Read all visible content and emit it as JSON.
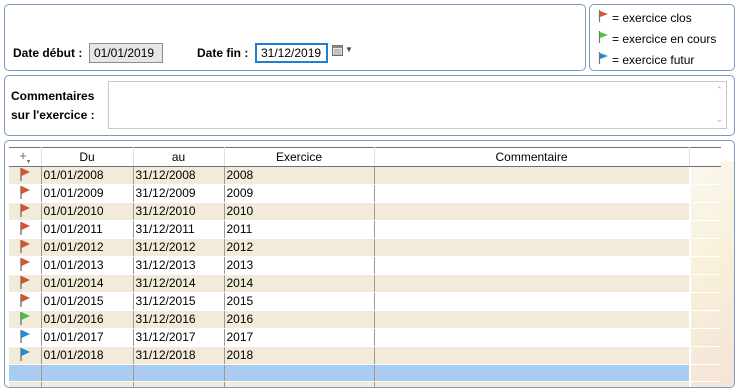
{
  "dates": {
    "start_label": "Date début :",
    "start_value": "01/01/2019",
    "end_label": "Date fin :",
    "end_value": "31/12/2019"
  },
  "legend": {
    "items": [
      {
        "color": "#d9542b",
        "label": "= exercice clos"
      },
      {
        "color": "#4cc23d",
        "label": "= exercice en cours"
      },
      {
        "color": "#1f8bd8",
        "label": "= exercice futur"
      }
    ]
  },
  "comment": {
    "label_line1": "Commentaires",
    "label_line2": "sur l'exercice :",
    "value": ""
  },
  "grid": {
    "columns": [
      "Du",
      "au",
      "Exercice",
      "Commentaire"
    ],
    "rows": [
      {
        "status": "clos",
        "du": "01/01/2008",
        "au": "31/12/2008",
        "exercice": "2008",
        "commentaire": ""
      },
      {
        "status": "clos",
        "du": "01/01/2009",
        "au": "31/12/2009",
        "exercice": "2009",
        "commentaire": ""
      },
      {
        "status": "clos",
        "du": "01/01/2010",
        "au": "31/12/2010",
        "exercice": "2010",
        "commentaire": ""
      },
      {
        "status": "clos",
        "du": "01/01/2011",
        "au": "31/12/2011",
        "exercice": "2011",
        "commentaire": ""
      },
      {
        "status": "clos",
        "du": "01/01/2012",
        "au": "31/12/2012",
        "exercice": "2012",
        "commentaire": ""
      },
      {
        "status": "clos",
        "du": "01/01/2013",
        "au": "31/12/2013",
        "exercice": "2013",
        "commentaire": ""
      },
      {
        "status": "clos",
        "du": "01/01/2014",
        "au": "31/12/2014",
        "exercice": "2014",
        "commentaire": ""
      },
      {
        "status": "clos",
        "du": "01/01/2015",
        "au": "31/12/2015",
        "exercice": "2015",
        "commentaire": ""
      },
      {
        "status": "en_cours",
        "du": "01/01/2016",
        "au": "31/12/2016",
        "exercice": "2016",
        "commentaire": ""
      },
      {
        "status": "futur",
        "du": "01/01/2017",
        "au": "31/12/2017",
        "exercice": "2017",
        "commentaire": ""
      },
      {
        "status": "futur",
        "du": "01/01/2018",
        "au": "31/12/2018",
        "exercice": "2018",
        "commentaire": ""
      }
    ]
  },
  "status_colors": {
    "clos": "#d9542b",
    "en_cours": "#4cc23d",
    "futur": "#1f8bd8"
  }
}
